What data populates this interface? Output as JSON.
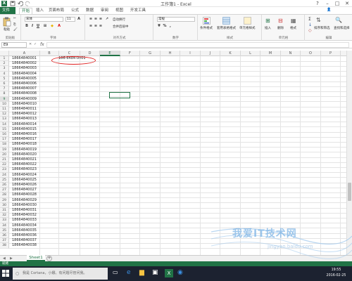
{
  "window": {
    "title": "工作簿1 - Excel",
    "app_icon_letter": "X"
  },
  "ribbon_tabs": [
    "文件",
    "开始",
    "插入",
    "页面布局",
    "公式",
    "数据",
    "审阅",
    "视图",
    "开发工具"
  ],
  "ribbon": {
    "clipboard": {
      "paste_label": "粘贴",
      "group_label": "剪贴板"
    },
    "font": {
      "font_name": "宋体",
      "font_size": "11",
      "group_label": "字体",
      "bold": "B",
      "italic": "I",
      "underline": "U"
    },
    "alignment": {
      "wrap_label": "自动换行",
      "merge_label": "合并后居中",
      "group_label": "对齐方式"
    },
    "number": {
      "format": "常规",
      "group_label": "数字",
      "percent": "%",
      "comma": ","
    },
    "styles": {
      "cond_label": "条件格式",
      "table_label": "套用表格格式",
      "cell_label": "单元格样式",
      "group_label": "样式"
    },
    "cells": {
      "insert_label": "插入",
      "delete_label": "删除",
      "format_label": "格式",
      "group_label": "单元格"
    },
    "editing": {
      "sort_label": "排序和筛选",
      "find_label": "查找和选择",
      "group_label": "编辑"
    }
  },
  "formula_bar": {
    "name_box": "E9",
    "fx": "fx"
  },
  "grid": {
    "columns": [
      "A",
      "B",
      "C",
      "D",
      "E",
      "F",
      "G",
      "H",
      "I",
      "J",
      "K",
      "L",
      "M",
      "N",
      "O",
      "P",
      "Q"
    ],
    "column_a_values": [
      "18664840001",
      "18664840002",
      "18664840003",
      "18664840004",
      "18664840005",
      "18664840006",
      "18664840007",
      "18664840008",
      "18664840009",
      "18664840010",
      "18664840011",
      "18664840012",
      "18664840013",
      "18664840014",
      "18664840015",
      "18664840016",
      "18664840017",
      "18664840018",
      "18664840019",
      "18664840020",
      "18664840021",
      "18664840022",
      "18664840023",
      "18664840024",
      "18664840025",
      "18664840026",
      "18664840027",
      "18664840028",
      "18664840029",
      "18664840030",
      "18664840031",
      "18664840032",
      "18664840033",
      "18664840034",
      "18664840035",
      "18664840036",
      "18664840037",
      "18664840038"
    ],
    "b1_value": "186-6484-0001",
    "selected_cell": "E9"
  },
  "sheet_tabs": [
    "Sheet1"
  ],
  "status_bar": {
    "text": "就绪"
  },
  "taskbar": {
    "search_placeholder": "我是 Cortana，小娜。有问题尽管问我。",
    "time": "19:55",
    "date": "2016-02-25"
  },
  "watermark": {
    "text": "我爱IT技术网",
    "url": "jingyan.baidu.com"
  },
  "colors": {
    "excel_green": "#217346",
    "oval_red": "#e02020",
    "taskbar": "#1c2230"
  }
}
